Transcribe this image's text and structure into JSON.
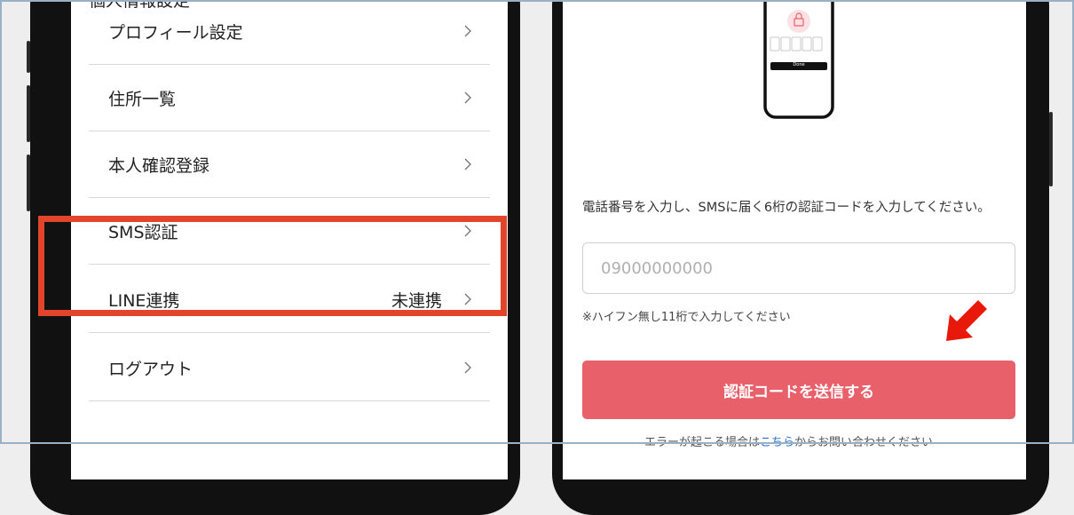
{
  "left_screen": {
    "section_title": "個人情報設定",
    "menu_items": [
      {
        "label": "プロフィール設定",
        "status": ""
      },
      {
        "label": "住所一覧",
        "status": ""
      },
      {
        "label": "本人確認登録",
        "status": ""
      },
      {
        "label": "SMS認証",
        "status": ""
      },
      {
        "label": "LINE連携",
        "status": "未連携"
      },
      {
        "label": "ログアウト",
        "status": ""
      }
    ],
    "highlighted_item": "SMS認証"
  },
  "right_screen": {
    "illustration": {
      "icon": "lock-icon",
      "button_label": "Done"
    },
    "description": "電話番号を入力し、SMSに届く6桁の認証コードを入力してください。",
    "phone_input": {
      "placeholder": "09000000000",
      "value": ""
    },
    "hint": "※ハイフン無し11桁で入力してください",
    "send_button_label": "認証コードを送信する",
    "footer": {
      "text_before": "エラーが起こる場合は",
      "link": "こちら",
      "text_after": "からお問い合わせください"
    }
  },
  "colors": {
    "highlight": "#e2452b",
    "button": "#e8606a",
    "arrow": "#e8190b",
    "link": "#2a6fc9"
  }
}
